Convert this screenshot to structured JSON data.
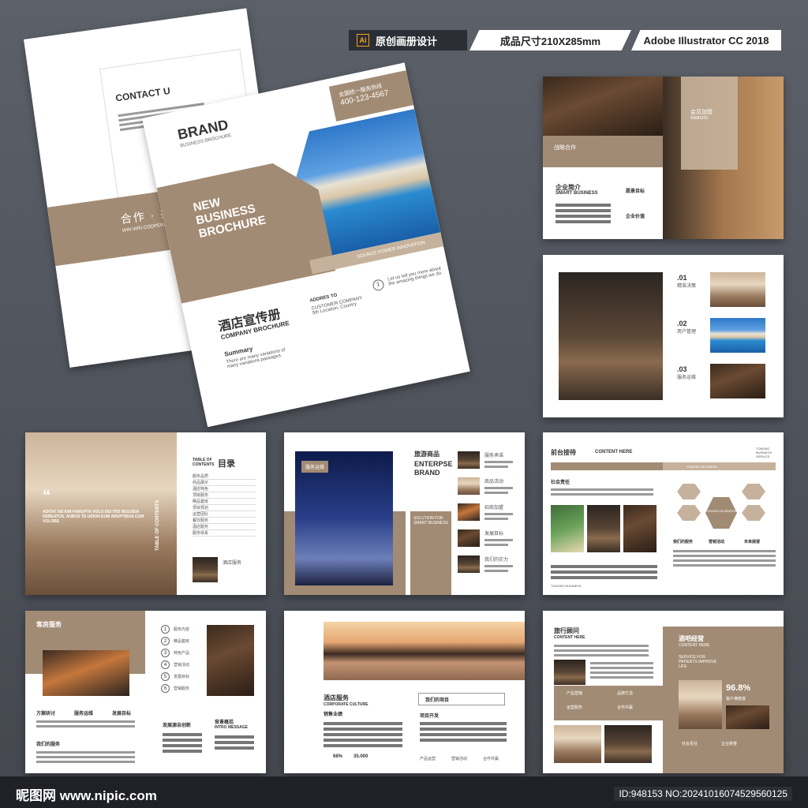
{
  "tags": {
    "ai_badge": "Ai",
    "design_type": "原创画册设计",
    "size": "成品尺寸210X285mm",
    "software": "Adobe Illustrator CC 2018"
  },
  "back_cover": {
    "contact": "CONTACT U",
    "slogan": "合作 · 共赢 · 创",
    "slogan_en": "WIN-WIN COOPERATION A"
  },
  "front_cover": {
    "brand": "BRAND",
    "brand_sub": "BUSINESS BROCHURE",
    "hotline_label": "全国统一服务热线",
    "hotline": "400-123-4567",
    "headline": [
      "NEW",
      "BUSINESS",
      "BROCHURE"
    ],
    "source": "SOURCE POWER INNOVATION",
    "title_cn": "酒店宣传册",
    "title_en": "COMPANY BROCHURE",
    "summary": "Summary",
    "summary_text": "There are many variations of many variations passages.",
    "address_label": "ADDRES TO",
    "address_text": "CUSTOMER COMPANY 5th Location, Country",
    "step": "1",
    "tagline": "Let us tell you more about the amazing things we do."
  },
  "spread1": {
    "left_label": "战略合作",
    "sub1": "企业简介",
    "sub1_en": "SMART BUSINESS",
    "sub2": "愿景目标",
    "sub3": "企业价值",
    "right_title": "会员加盟",
    "right_sub": "WEBSITE"
  },
  "spread2": {
    "items": [
      {
        "num": ".01",
        "label": "精准决策"
      },
      {
        "num": ".02",
        "label": "用户管理"
      },
      {
        "num": ".03",
        "label": "服务运维"
      }
    ]
  },
  "spread3": {
    "quote": "“",
    "quote_text": "ADITAT AB IUM HARUPTA VOLO DEI ITIO NEGUEIA DEBEATUS. AUBUS TE UDION EUM ARUPTIBUS CUM VOLOBE",
    "vertical": "TABLE OF CONTENTS",
    "toc_en": "TABLE OF CONTENTS",
    "toc_cn": "目录",
    "toc": [
      "服务品质",
      "商品展示",
      "酒店特色",
      "顶级服务",
      "精品套房",
      "项目规划",
      "运营团队",
      "餐饮服务",
      "酒店服务",
      "服务体系"
    ],
    "bottom_item": "酒店服务"
  },
  "spread4": {
    "photo_label": "服务运维",
    "title": "旅游商品",
    "title_en1": "ENTERPSE",
    "title_en2": "BRAND",
    "box_text": "SOLUTION FOR SMART BUSINESS",
    "items": [
      "服务承诺",
      "商品活动",
      "招商加盟",
      "发展目标",
      "我们的实力"
    ]
  },
  "spread5": {
    "title": "前台接待",
    "sub": "CONTENT HERE",
    "section": "社会责任",
    "brand": "TONGBO BUSINESS",
    "center": "TONGBO BUSINESS",
    "cols": [
      "我们的服务",
      "营销活动",
      "未来展望"
    ],
    "footer": "TONGBO BUSINESS",
    "corner": "TONGBO BUSINESS SERVICE"
  },
  "spread6": {
    "title": "客房服务",
    "icons": [
      "方案研讨",
      "服务运维",
      "发展目标"
    ],
    "bottom": "我们的服务",
    "steps": [
      "1",
      "2",
      "3",
      "4",
      "5",
      "6"
    ],
    "step_labels": [
      "服务内容",
      "精品套房",
      "特色产品",
      "营销活动",
      "发展目标",
      "营销服务"
    ],
    "col2_title": "发展源自创新",
    "intro": "背景概括",
    "intro_en": "INTRO MESSAGE"
  },
  "spread7": {
    "title": "酒店服务",
    "sub": "CORPORATE CULTURE",
    "label": "销售业绩",
    "box": "我们的项目",
    "right_label": "项目开发",
    "stats": [
      "68%",
      "35.000"
    ],
    "icons": [
      "产品运营",
      "营销活动",
      "合作共赢"
    ]
  },
  "spread8": {
    "title": "旅行顾问",
    "sub": "CONTENT HERE",
    "right_title": "酒吧经营",
    "right_sub": "CONTENT HERE",
    "service": "SERVICE FOR PATIENTS IMPROVE LIFE",
    "stat": "96.8%",
    "stat_label": "客户满意度",
    "items": [
      "产品营销",
      "品牌打造",
      "运营服务",
      "合作共赢"
    ],
    "bottom": [
      "社会责任",
      "企业荣誉"
    ]
  },
  "footer": {
    "logo": "昵图网 www.nipic.com",
    "id": "ID:948153 NO:20241016074529560125"
  }
}
